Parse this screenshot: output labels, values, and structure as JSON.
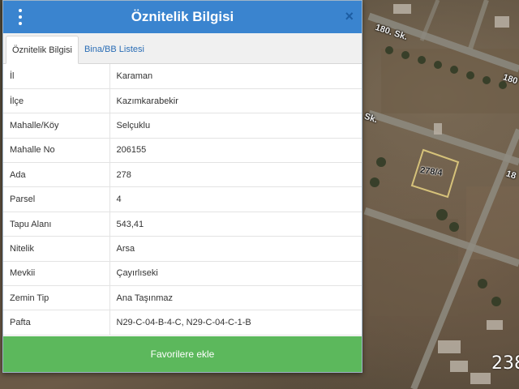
{
  "panel": {
    "title": "Öznitelik Bilgisi",
    "menu_icon": "vertical-dots-icon",
    "close_icon": "close-icon",
    "close_label": "×",
    "tabs": [
      {
        "label": "Öznitelik Bilgisi",
        "active": true
      },
      {
        "label": "Bina/BB Listesi",
        "active": false
      }
    ],
    "rows": [
      {
        "key": "İl",
        "value": "Karaman"
      },
      {
        "key": "İlçe",
        "value": "Kazımkarabekir"
      },
      {
        "key": "Mahalle/Köy",
        "value": "Selçuklu"
      },
      {
        "key": "Mahalle No",
        "value": "206155"
      },
      {
        "key": "Ada",
        "value": "278"
      },
      {
        "key": "Parsel",
        "value": "4"
      },
      {
        "key": "Tapu Alanı",
        "value": "543,41"
      },
      {
        "key": "Nitelik",
        "value": "Arsa"
      },
      {
        "key": "Mevkii",
        "value": "Çayırlıseki"
      },
      {
        "key": "Zemin Tip",
        "value": "Ana Taşınmaz"
      },
      {
        "key": "Pafta",
        "value": "N29-C-04-B-4-C, N29-C-04-C-1-B"
      }
    ],
    "favorite_button": "Favorilere ekle"
  },
  "map": {
    "street_labels": [
      "180. Sk.",
      "180",
      "Sk.",
      "18"
    ],
    "parcel_label": "278/4",
    "scale_text": "238"
  },
  "colors": {
    "header": "#3a84cf",
    "favorite_button": "#5cb85c",
    "tab_link": "#2a6db5",
    "parcel_outline": "#d6c27a"
  }
}
